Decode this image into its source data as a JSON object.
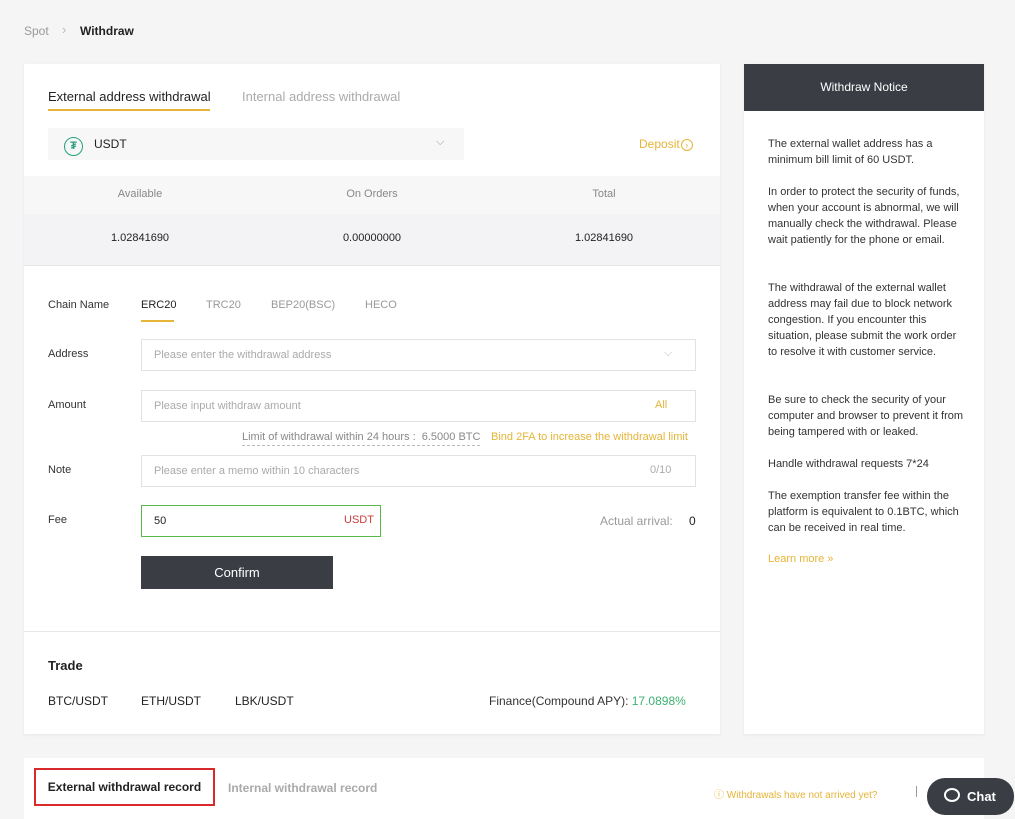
{
  "breadcrumb": {
    "spot": "Spot",
    "current": "Withdraw"
  },
  "tabs": {
    "external": "External address withdrawal",
    "internal": "Internal address withdrawal"
  },
  "coin": {
    "name": "USDT",
    "icon": "tether-icon",
    "deposit": "Deposit"
  },
  "balance": {
    "headers": [
      "Available",
      "On Orders",
      "Total"
    ],
    "values": [
      "1.02841690",
      "0.00000000",
      "1.02841690"
    ]
  },
  "form": {
    "chain_label": "Chain Name",
    "chains": [
      "ERC20",
      "TRC20",
      "BEP20(BSC)",
      "HECO"
    ],
    "address_label": "Address",
    "address_placeholder": "Please enter the withdrawal address",
    "amount_label": "Amount",
    "amount_placeholder": "Please input withdraw amount",
    "all": "All",
    "limit_text": "Limit of withdrawal within 24 hours :  6.5000 BTC",
    "bind_text": "Bind 2FA to increase the withdrawal limit",
    "note_label": "Note",
    "note_placeholder": "Please enter a memo within 10 characters",
    "note_count": "0/10",
    "fee_label": "Fee",
    "fee_value": "50",
    "fee_unit": "USDT",
    "arrival_label": "Actual arrival:",
    "arrival_value": "0",
    "confirm": "Confirm"
  },
  "trade": {
    "title": "Trade",
    "pairs": [
      "BTC/USDT",
      "ETH/USDT",
      "LBK/USDT"
    ],
    "finance_label": "Finance(Compound APY):",
    "finance_value": "17.0898%"
  },
  "notice": {
    "title": "Withdraw Notice",
    "paragraphs": [
      "The external wallet address has a minimum bill limit of 60 USDT.",
      "In order to protect the security of funds, when your account is abnormal, we will manually check the withdrawal. Please wait patiently for the phone or email.",
      "The withdrawal of the external wallet address may fail due to block network congestion. If you encounter this situation, please submit the work order to resolve it with customer service.",
      "Be sure to check the security of your computer and browser to prevent it from being tampered with or leaked.",
      "Handle withdrawal requests 7*24",
      "The exemption transfer fee within the platform is equivalent to 0.1BTC, which can be received in real time."
    ],
    "learn_more": "Learn more »"
  },
  "records": {
    "external": "External withdrawal record",
    "internal": "Internal withdrawal record",
    "not_arrived": "Withdrawals have not arrived yet?",
    "chat": "Chat"
  },
  "colors": {
    "accent": "#e6b437",
    "dark": "#3b3d45",
    "positive": "#3cb371",
    "fee_border": "#58b84a"
  }
}
